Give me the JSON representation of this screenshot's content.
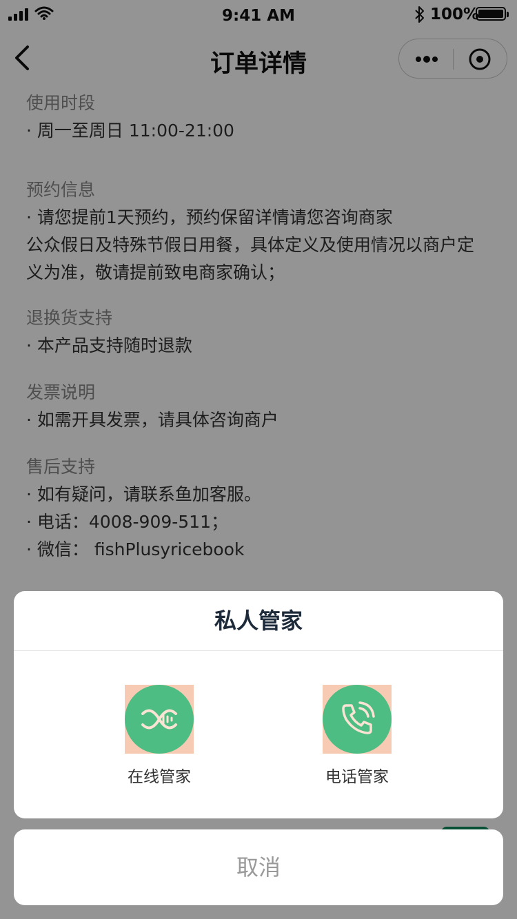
{
  "status_bar": {
    "time": "9:41 AM",
    "battery": "100%"
  },
  "nav": {
    "title": "订单详情",
    "back_icon": "chevron-left-icon",
    "more_icon": "more-icon",
    "target_icon": "target-icon"
  },
  "sections": [
    {
      "title": "使用时段",
      "lines": [
        "· 周一至周日 11:00-21:00"
      ]
    },
    {
      "title": "预约信息",
      "lines": [
        "· 请您提前1天预约，预约保留详情请您咨询商家",
        "公众假日及特殊节假日用餐，具体定义及使用情况以商户定",
        "义为准，敬请提前致电商家确认；"
      ]
    },
    {
      "title": "退换货支持",
      "lines": [
        "· 本产品支持随时退款"
      ]
    },
    {
      "title": "发票说明",
      "lines": [
        "· 如需开具发票，请具体咨询商户"
      ]
    },
    {
      "title": "售后支持",
      "lines": [
        "· 如有疑问，请联系鱼加客服。",
        "· 电话：4008-909-511；",
        "· 微信：  fishPlusyricebook"
      ]
    }
  ],
  "sheet": {
    "title": "私人管家",
    "options": [
      {
        "label": "在线管家",
        "icon": "dna-icon"
      },
      {
        "label": "电话管家",
        "icon": "phone-icon"
      }
    ],
    "cancel": "取消"
  },
  "colors": {
    "accent_green": "#4dbd84",
    "icon_bg": "#f7cbb3"
  }
}
